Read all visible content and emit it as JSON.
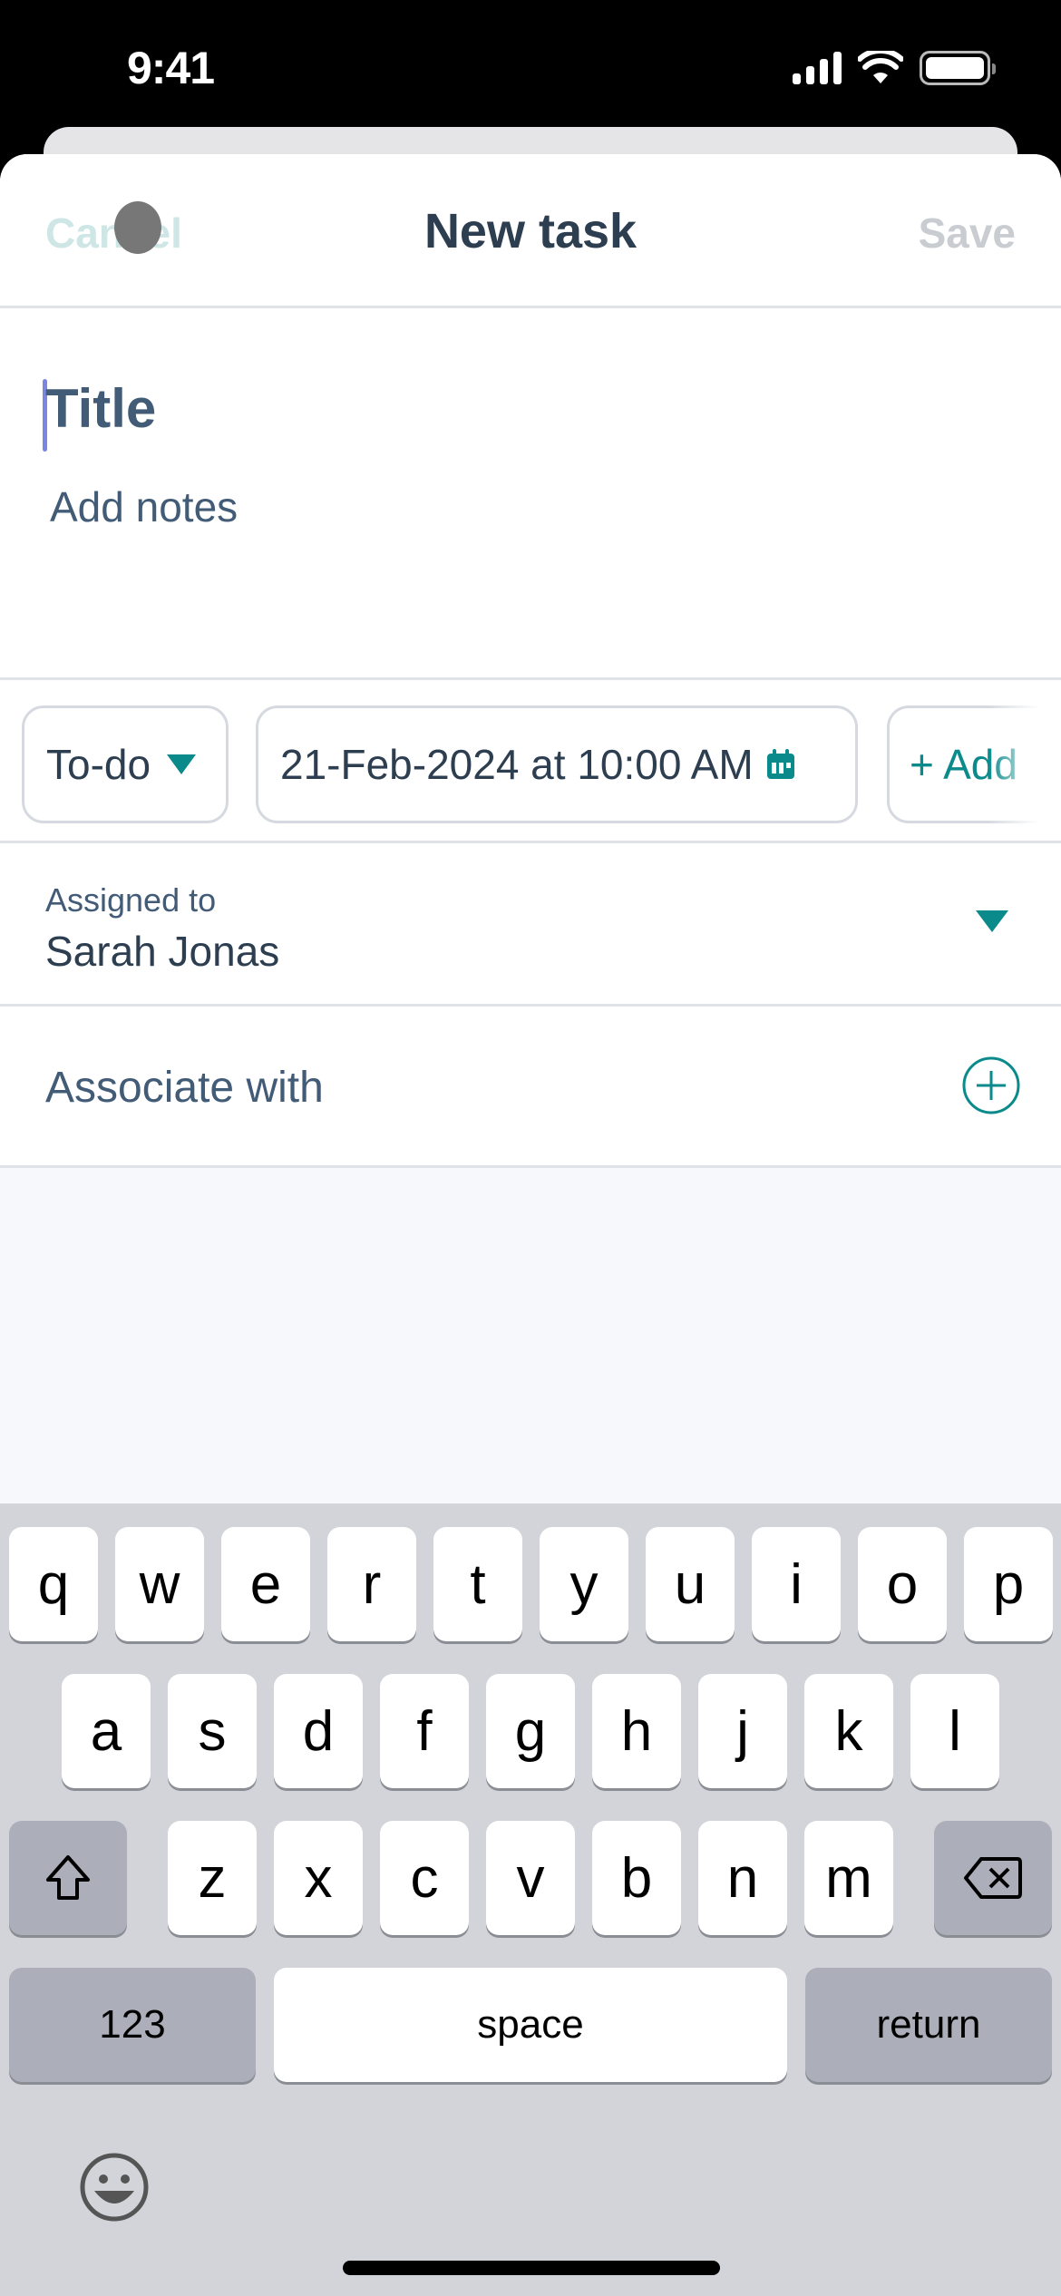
{
  "status_bar": {
    "time": "9:41"
  },
  "nav": {
    "cancel": "Cancel",
    "title": "New task",
    "save": "Save"
  },
  "editor": {
    "title_placeholder": "Title",
    "notes_placeholder": "Add notes"
  },
  "chips": {
    "status": "To-do",
    "due_date": "21-Feb-2024 at 10:00 AM",
    "add": "+ Add"
  },
  "assigned": {
    "label": "Assigned to",
    "value": "Sarah Jonas"
  },
  "associate": {
    "label": "Associate with"
  },
  "colors": {
    "accent": "#0b8a8c",
    "text": "#2d3e50",
    "muted": "#425b76"
  },
  "keyboard": {
    "row1": [
      "q",
      "w",
      "e",
      "r",
      "t",
      "y",
      "u",
      "i",
      "o",
      "p"
    ],
    "row2": [
      "a",
      "s",
      "d",
      "f",
      "g",
      "h",
      "j",
      "k",
      "l"
    ],
    "row3": [
      "z",
      "x",
      "c",
      "v",
      "b",
      "n",
      "m"
    ],
    "numbers": "123",
    "space": "space",
    "return": "return"
  }
}
